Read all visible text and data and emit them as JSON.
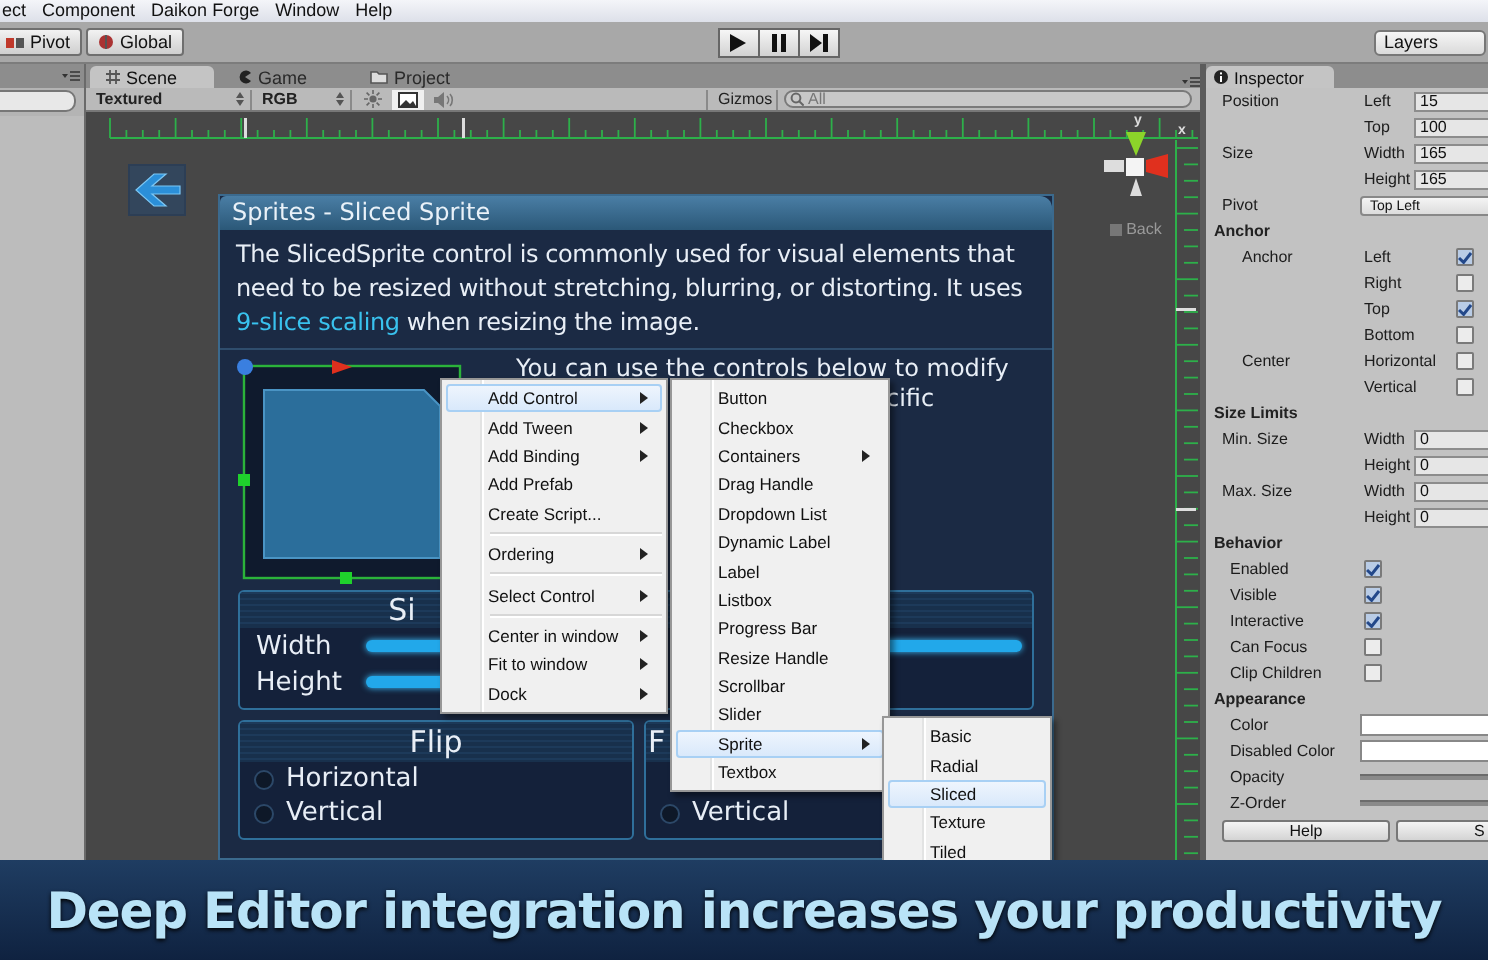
{
  "menu_bar": [
    "ect",
    "Component",
    "Daikon Forge",
    "Window",
    "Help"
  ],
  "toolbar": {
    "pivot": "Pivot",
    "global": "Global",
    "layers": "Layers"
  },
  "scene_tabs": [
    {
      "label": "Scene",
      "selected": true
    },
    {
      "label": "Game",
      "selected": false
    },
    {
      "label": "Project",
      "selected": false
    }
  ],
  "scene_toolbar": {
    "render_mode": "Textured",
    "channel": "RGB",
    "gizmos": "Gizmos",
    "search": {
      "placeholder": "All"
    },
    "view_toggles": [
      {
        "kind": "sun",
        "selected": false
      },
      {
        "kind": "image",
        "selected": true
      },
      {
        "kind": "speaker",
        "selected": false
      }
    ]
  },
  "gizmo": {
    "axis_labels": [
      "y",
      "x"
    ],
    "back_label": "Back"
  },
  "demo_window": {
    "title": "Sprites - Sliced Sprite",
    "description_start": "The SlicedSprite control is commonly used for visual elements that need to be resized without stretching, blurring, or distorting. It uses ",
    "link": "9-slice scaling",
    "description_end": " when resizing the image.",
    "note_lines": [
      "You can use the controls below to modify",
      "cific"
    ],
    "size_panel": {
      "title": "Si",
      "sliders": [
        {
          "label": "Width",
          "level": 1
        },
        {
          "label": "Height",
          "level": 1
        }
      ]
    },
    "flip_panel": {
      "title": "Flip",
      "options": [
        {
          "label": "Horizontal",
          "checked": false
        },
        {
          "label": "Vertical",
          "checked": false
        }
      ]
    },
    "right_slider": {
      "level": 1
    },
    "right_panel": {
      "title": "F",
      "options": [
        {
          "label": "Vertical",
          "checked": false
        }
      ]
    }
  },
  "context_menu": {
    "items": [
      {
        "kind": "item",
        "label": "Add Control",
        "submenu": true,
        "selected": true
      },
      {
        "kind": "item",
        "label": "Add Tween",
        "submenu": true,
        "selected": false
      },
      {
        "kind": "item",
        "label": "Add Binding",
        "submenu": true,
        "selected": false
      },
      {
        "kind": "item",
        "label": "Add Prefab",
        "submenu": false,
        "selected": false
      },
      {
        "kind": "item",
        "label": "Create Script...",
        "submenu": false,
        "selected": false
      },
      {
        "kind": "separator"
      },
      {
        "kind": "item",
        "label": "Ordering",
        "submenu": true,
        "selected": false
      },
      {
        "kind": "separator"
      },
      {
        "kind": "item",
        "label": "Select Control",
        "submenu": true,
        "selected": false
      },
      {
        "kind": "separator"
      },
      {
        "kind": "item",
        "label": "Center in window",
        "submenu": true,
        "selected": false
      },
      {
        "kind": "item",
        "label": "Fit to window",
        "submenu": true,
        "selected": false
      },
      {
        "kind": "item",
        "label": "Dock",
        "submenu": true,
        "selected": false
      }
    ]
  },
  "control_menu": {
    "items": [
      {
        "kind": "item",
        "label": "Button",
        "submenu": false,
        "selected": false
      },
      {
        "kind": "item",
        "label": "Checkbox",
        "submenu": false,
        "selected": false
      },
      {
        "kind": "item",
        "label": "Containers",
        "submenu": true,
        "selected": false
      },
      {
        "kind": "item",
        "label": "Drag Handle",
        "submenu": false,
        "selected": false
      },
      {
        "kind": "item",
        "label": "Dropdown List",
        "submenu": false,
        "selected": false
      },
      {
        "kind": "item",
        "label": "Dynamic Label",
        "submenu": false,
        "selected": false
      },
      {
        "kind": "item",
        "label": "Label",
        "submenu": false,
        "selected": false
      },
      {
        "kind": "item",
        "label": "Listbox",
        "submenu": false,
        "selected": false
      },
      {
        "kind": "item",
        "label": "Progress Bar",
        "submenu": false,
        "selected": false
      },
      {
        "kind": "item",
        "label": "Resize Handle",
        "submenu": false,
        "selected": false
      },
      {
        "kind": "item",
        "label": "Scrollbar",
        "submenu": false,
        "selected": false
      },
      {
        "kind": "item",
        "label": "Slider",
        "submenu": false,
        "selected": false
      },
      {
        "kind": "item",
        "label": "Sprite",
        "submenu": true,
        "selected": true
      },
      {
        "kind": "item",
        "label": "Textbox",
        "submenu": false,
        "selected": false
      }
    ]
  },
  "sprite_menu": {
    "items": [
      {
        "kind": "item",
        "label": "Basic",
        "submenu": false,
        "selected": false
      },
      {
        "kind": "item",
        "label": "Radial",
        "submenu": false,
        "selected": false
      },
      {
        "kind": "item",
        "label": "Sliced",
        "submenu": false,
        "selected": true
      },
      {
        "kind": "item",
        "label": "Texture",
        "submenu": false,
        "selected": false
      },
      {
        "kind": "item",
        "label": "Tiled",
        "submenu": false,
        "selected": false
      }
    ]
  },
  "inspector": {
    "tab": "Inspector",
    "rows": [
      {
        "kind": "field",
        "label": "Position",
        "sub": "Left",
        "value": "15"
      },
      {
        "kind": "field",
        "sub": "Top",
        "value": "100"
      },
      {
        "kind": "field",
        "label": "Size",
        "sub": "Width",
        "value": "165"
      },
      {
        "kind": "field",
        "sub": "Height",
        "value": "165"
      },
      {
        "kind": "dropdown",
        "label": "Pivot",
        "value": "Top Left"
      },
      {
        "kind": "heading",
        "label": "Anchor"
      },
      {
        "kind": "check",
        "label": "Anchor",
        "sub": "Left",
        "checked": true
      },
      {
        "kind": "check",
        "sub": "Right",
        "checked": false
      },
      {
        "kind": "check",
        "sub": "Top",
        "checked": true
      },
      {
        "kind": "check",
        "sub": "Bottom",
        "checked": false
      },
      {
        "kind": "check",
        "label": "Center",
        "sub": "Horizontal",
        "checked": false
      },
      {
        "kind": "check",
        "sub": "Vertical",
        "checked": false
      },
      {
        "kind": "heading",
        "label": "Size Limits"
      },
      {
        "kind": "field",
        "label": "Min. Size",
        "sub": "Width",
        "value": "0"
      },
      {
        "kind": "field",
        "sub": "Height",
        "value": "0"
      },
      {
        "kind": "field",
        "label": "Max. Size",
        "sub": "Width",
        "value": "0"
      },
      {
        "kind": "field",
        "sub": "Height",
        "value": "0"
      },
      {
        "kind": "heading",
        "label": "Behavior"
      },
      {
        "kind": "toggle",
        "label": "Enabled",
        "checked": true
      },
      {
        "kind": "toggle",
        "label": "Visible",
        "checked": true
      },
      {
        "kind": "toggle",
        "label": "Interactive",
        "checked": true
      },
      {
        "kind": "toggle",
        "label": "Can Focus",
        "checked": false
      },
      {
        "kind": "toggle",
        "label": "Clip Children",
        "checked": false
      },
      {
        "kind": "heading",
        "label": "Appearance"
      },
      {
        "kind": "color",
        "label": "Color"
      },
      {
        "kind": "color",
        "label": "Disabled Color"
      },
      {
        "kind": "line",
        "label": "Opacity"
      },
      {
        "kind": "line",
        "label": "Z-Order"
      }
    ],
    "buttons": [
      "Help",
      "S"
    ]
  },
  "banner": "Deep Editor integration increases your productivity"
}
